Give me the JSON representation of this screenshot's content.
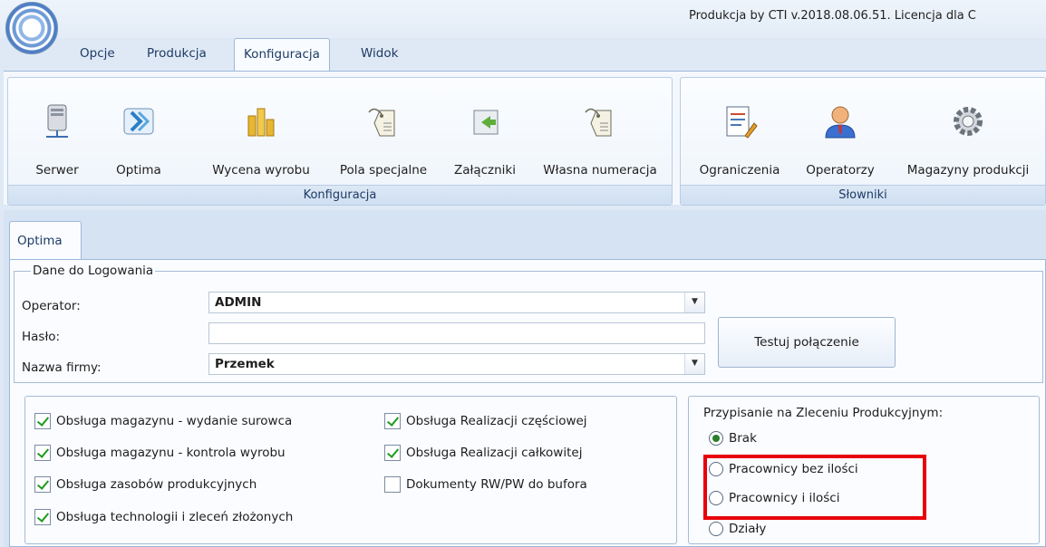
{
  "window": {
    "title": "Produkcja by CTI v.2018.08.06.51. Licencja dla C"
  },
  "menu": {
    "tabs": [
      "Opcje",
      "Produkcja",
      "Konfiguracja",
      "Widok"
    ],
    "active": "Konfiguracja"
  },
  "ribbon": {
    "konfiguracja_group": {
      "label": "Konfiguracja",
      "buttons": [
        "Serwer",
        "Optima",
        "Wycena wyrobu",
        "Pola specjalne",
        "Załączniki",
        "Własna numeracja"
      ]
    },
    "slowniki_group": {
      "label": "Słowniki",
      "buttons": [
        "Ograniczenia",
        "Operatorzy",
        "Magazyny produkcji"
      ]
    }
  },
  "panel": {
    "tab": "Optima",
    "login": {
      "legend": "Dane do Logowania",
      "operator_label": "Operator:",
      "operator_value": "ADMIN",
      "password_label": "Hasło:",
      "password_value": "",
      "company_label": "Nazwa firmy:",
      "company_value": "Przemek",
      "test_button": "Testuj połączenie"
    },
    "options": {
      "left": [
        {
          "label": "Obsługa magazynu - wydanie surowca",
          "checked": true
        },
        {
          "label": "Obsługa magazynu - kontrola wyrobu",
          "checked": true
        },
        {
          "label": "Obsługa zasobów produkcyjnych",
          "checked": true
        },
        {
          "label": "Obsługa technologii i zleceń złożonych",
          "checked": true
        }
      ],
      "right": [
        {
          "label": "Obsługa Realizacji częściowej",
          "checked": true
        },
        {
          "label": "Obsługa Realizacji całkowitej",
          "checked": true
        },
        {
          "label": "Dokumenty RW/PW do bufora",
          "checked": false
        }
      ]
    },
    "assignment": {
      "title": "Przypisanie na Zleceniu Produkcyjnym:",
      "options": [
        "Brak",
        "Pracownicy bez ilości",
        "Pracownicy i ilości",
        "Działy"
      ],
      "selected": "Brak"
    }
  },
  "colors": {
    "highlight": "#e8000b",
    "check": "#1d9a1d"
  }
}
